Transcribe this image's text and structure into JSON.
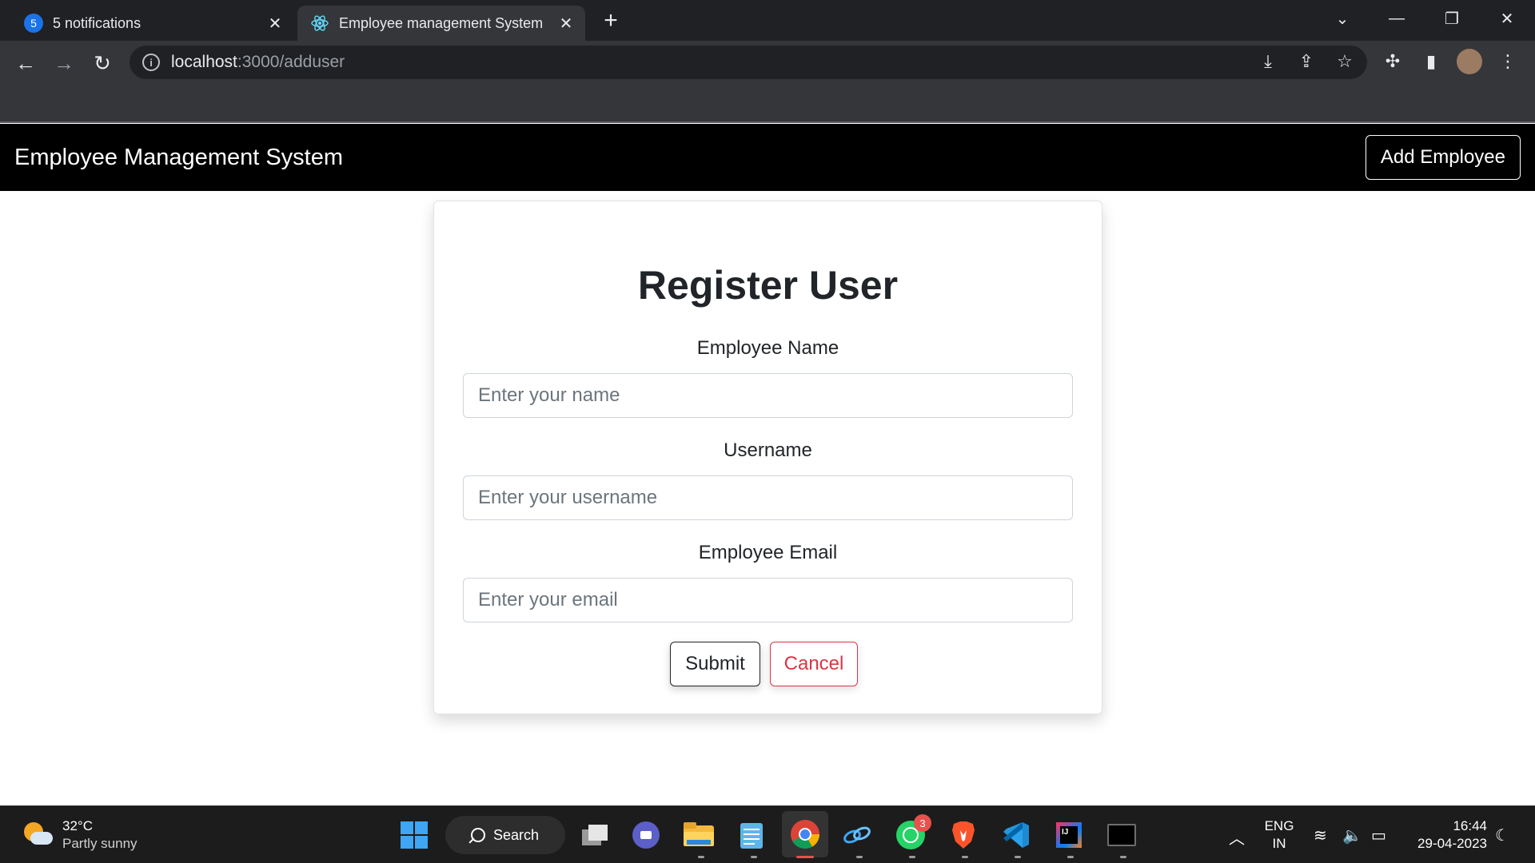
{
  "browser": {
    "tabs": [
      {
        "label": "5 notifications",
        "badge": "5"
      },
      {
        "label": "Employee management System"
      }
    ],
    "new_tab": "+",
    "address": {
      "host": "localhost",
      "path": ":3000/adduser"
    }
  },
  "app": {
    "brand": "Employee Management System",
    "add_employee_label": "Add Employee"
  },
  "form": {
    "title": "Register User",
    "fields": [
      {
        "label": "Employee Name",
        "placeholder": "Enter your name",
        "value": ""
      },
      {
        "label": "Username",
        "placeholder": "Enter your username",
        "value": ""
      },
      {
        "label": "Employee Email",
        "placeholder": "Enter your email",
        "value": ""
      }
    ],
    "submit_label": "Submit",
    "cancel_label": "Cancel",
    "colors": {
      "submit": "#212529",
      "cancel": "#dc3545"
    }
  },
  "taskbar": {
    "weather": {
      "temp": "32°C",
      "condition": "Partly sunny"
    },
    "search_label": "Search",
    "whatsapp_badge": "3",
    "lang": {
      "line1": "ENG",
      "line2": "IN"
    },
    "clock": {
      "time": "16:44",
      "date": "29-04-2023"
    }
  }
}
